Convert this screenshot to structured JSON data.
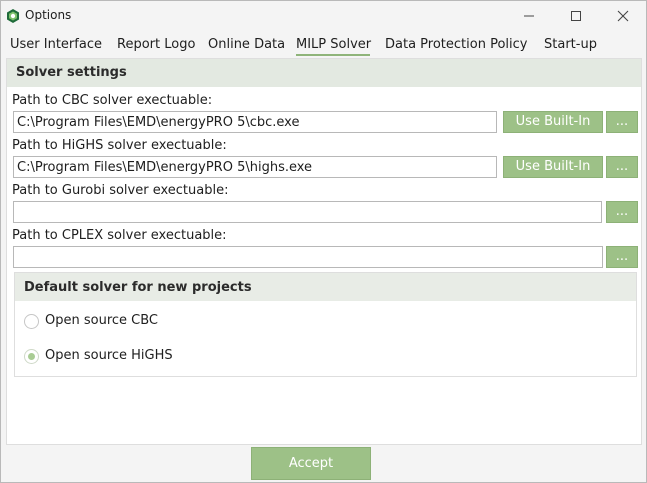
{
  "window": {
    "title": "Options",
    "icon": "energypro-logo-icon"
  },
  "tabs": [
    {
      "label": "User Interface"
    },
    {
      "label": "Report Logo"
    },
    {
      "label": "Online Data"
    },
    {
      "label": "MILP Solver"
    },
    {
      "label": "Data Protection Policy"
    },
    {
      "label": "Start-up"
    }
  ],
  "active_tab": "MILP Solver",
  "solver_settings": {
    "title": "Solver settings",
    "cbc": {
      "label": "Path to CBC solver exectuable:",
      "value": "C:\\Program Files\\EMD\\energyPRO 5\\cbc.exe",
      "builtin_label": "Use Built-In",
      "browse_label": "..."
    },
    "highs": {
      "label": "Path to HiGHS solver exectuable:",
      "value": "C:\\Program Files\\EMD\\energyPRO 5\\highs.exe",
      "builtin_label": "Use Built-In",
      "browse_label": "..."
    },
    "gurobi": {
      "label": "Path to Gurobi solver exectuable:",
      "value": "",
      "browse_label": "..."
    },
    "cplex": {
      "label": "Path to CPLEX solver exectuable:",
      "value": "",
      "browse_label": "..."
    }
  },
  "default_solver": {
    "title": "Default solver for new projects",
    "options": [
      {
        "label": "Open source CBC",
        "checked": false
      },
      {
        "label": "Open source HiGHS",
        "checked": true
      }
    ]
  },
  "accept_label": "Accept",
  "colors": {
    "accent_green": "#9dc187",
    "section_header": "#e3e9e1",
    "tab_underline": "#8fb47a"
  }
}
